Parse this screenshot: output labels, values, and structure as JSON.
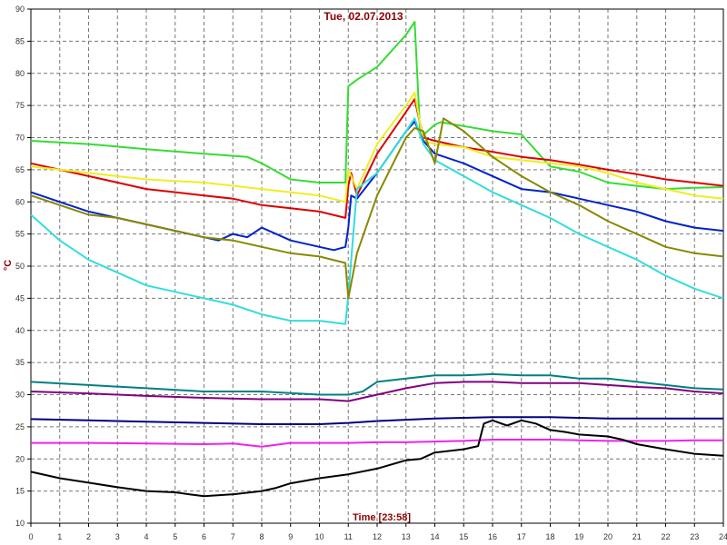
{
  "chart_data": {
    "type": "line",
    "title": "Tue, 02.07.2013",
    "xlabel": "Time [23:58]",
    "ylabel": "°C",
    "xlim": [
      0,
      24
    ],
    "ylim": [
      10,
      90
    ],
    "x_ticks": [
      0,
      1,
      2,
      3,
      4,
      5,
      6,
      7,
      8,
      9,
      10,
      11,
      12,
      13,
      14,
      15,
      16,
      17,
      18,
      19,
      20,
      21,
      22,
      23,
      24
    ],
    "y_ticks": [
      10,
      15,
      20,
      25,
      30,
      35,
      40,
      45,
      50,
      55,
      60,
      65,
      70,
      75,
      80,
      85,
      90
    ],
    "grid": true,
    "series": [
      {
        "color": "#33dd33",
        "x": [
          0,
          2,
          4,
          6,
          7.5,
          8,
          9,
          10,
          10.9,
          11,
          11.3,
          12,
          13,
          13.3,
          13.5,
          14,
          14.2,
          15,
          16,
          17,
          18,
          19,
          20,
          21,
          22,
          23,
          24
        ],
        "y": [
          69.5,
          69,
          68.2,
          67.5,
          67,
          66,
          63.5,
          63,
          63,
          78,
          79,
          81,
          86,
          88,
          70,
          72,
          72.4,
          71.8,
          71,
          70.5,
          65.5,
          64.7,
          63,
          62.5,
          62,
          62.2,
          62.3
        ]
      },
      {
        "color": "#dd0000",
        "x": [
          0,
          1,
          2,
          3,
          4,
          5,
          6,
          7,
          8,
          9,
          10,
          10.9,
          11,
          11.1,
          11.3,
          12,
          13,
          13.3,
          13.6,
          14,
          15,
          16,
          17,
          18,
          19,
          20,
          21,
          22,
          23,
          24
        ],
        "y": [
          66,
          65,
          64,
          63,
          62,
          61.5,
          61,
          60.5,
          59.5,
          59,
          58.5,
          57.5,
          62.5,
          64.5,
          61,
          67.5,
          74,
          76,
          70,
          69.5,
          68.5,
          67.8,
          67,
          66.5,
          65.8,
          65,
          64.3,
          63.5,
          63,
          62.5
        ]
      },
      {
        "color": "#eeee22",
        "x": [
          0,
          2,
          4,
          6,
          8,
          10,
          10.9,
          11,
          11.3,
          12,
          13,
          13.3,
          13.6,
          14,
          15,
          16,
          17,
          18,
          19,
          20,
          21,
          22,
          23,
          24
        ],
        "y": [
          65.5,
          64.5,
          63.5,
          63,
          62,
          61,
          60,
          65,
          62,
          69,
          75,
          77,
          69.5,
          69,
          68.5,
          67,
          66.5,
          66,
          65.5,
          64.5,
          63,
          62,
          61,
          60.5
        ]
      },
      {
        "color": "#0022cc",
        "x": [
          0,
          1,
          2,
          3,
          4,
          5,
          6,
          6.5,
          7,
          7.5,
          8,
          8.5,
          9,
          10,
          10.5,
          10.9,
          11,
          11.1,
          11.3,
          12,
          13,
          13.3,
          13.6,
          14,
          15,
          16,
          17,
          18,
          19,
          20,
          21,
          22,
          23,
          24
        ],
        "y": [
          61.5,
          60,
          58.5,
          57.5,
          56.5,
          55.5,
          54.5,
          54,
          55,
          54.5,
          56,
          55,
          54,
          53,
          52.5,
          53,
          56,
          61,
          60.5,
          64.5,
          71,
          72.5,
          69.5,
          67.5,
          66,
          64,
          62,
          61.5,
          60.5,
          59.5,
          58.5,
          57,
          56,
          55.5
        ]
      },
      {
        "color": "#33dddd",
        "x": [
          0,
          1,
          2,
          3,
          4,
          5,
          6,
          7,
          8,
          9,
          10,
          10.9,
          11,
          11.3,
          12,
          13,
          13.3,
          13.6,
          14,
          15,
          16,
          17,
          18,
          19,
          20,
          21,
          22,
          23,
          24
        ],
        "y": [
          58,
          54,
          51,
          49,
          47,
          46,
          45,
          44,
          42.5,
          41.5,
          41.5,
          41,
          45.5,
          62,
          64.5,
          71,
          73,
          69,
          66.5,
          64,
          61.5,
          59.5,
          57.5,
          55,
          53,
          51,
          48.5,
          46.5,
          45
        ]
      },
      {
        "color": "#888800",
        "x": [
          0,
          1,
          2,
          3,
          4,
          5,
          6,
          7,
          8,
          9,
          10,
          10.9,
          11,
          11.3,
          12,
          13,
          13.3,
          13.6,
          14,
          14.3,
          15,
          16,
          17,
          18,
          19,
          20,
          21,
          22,
          23,
          24
        ],
        "y": [
          61,
          59.5,
          58,
          57.5,
          56.5,
          55.5,
          54.5,
          54,
          53,
          52,
          51.5,
          50.5,
          45,
          52,
          61,
          70,
          71.5,
          71,
          66,
          73,
          71,
          67,
          64,
          61.5,
          59.5,
          57,
          55,
          53,
          52,
          51.5
        ]
      },
      {
        "color": "#008080",
        "x": [
          0,
          2,
          4,
          6,
          8,
          10,
          11,
          11.5,
          12,
          13,
          14,
          15,
          16,
          17,
          18,
          19,
          20,
          21,
          22,
          23,
          24
        ],
        "y": [
          32,
          31.5,
          31,
          30.5,
          30.5,
          30,
          30,
          30.5,
          32,
          32.5,
          33,
          33,
          33.2,
          33,
          33,
          32.5,
          32.5,
          32,
          31.5,
          31,
          30.8
        ]
      },
      {
        "color": "#800080",
        "x": [
          0,
          2,
          4,
          6,
          8,
          10,
          11,
          12,
          13,
          14,
          15,
          16,
          17,
          18,
          19,
          20,
          21,
          22,
          23,
          24
        ],
        "y": [
          30.5,
          30.2,
          29.8,
          29.5,
          29.3,
          29.3,
          29,
          30,
          31,
          31.8,
          32,
          32,
          31.8,
          31.8,
          31.8,
          31.5,
          31.2,
          31,
          30.5,
          30.2
        ]
      },
      {
        "color": "#000080",
        "x": [
          0,
          2,
          4,
          6,
          8,
          10,
          11,
          12,
          13,
          14,
          15,
          16,
          17,
          18,
          19,
          20,
          21,
          22,
          23,
          24
        ],
        "y": [
          26.2,
          26,
          25.8,
          25.6,
          25.4,
          25.4,
          25.6,
          25.9,
          26.1,
          26.3,
          26.4,
          26.5,
          26.5,
          26.5,
          26.4,
          26.3,
          26.3,
          26.3,
          26.3,
          26.3
        ]
      },
      {
        "color": "#ee22ee",
        "x": [
          0,
          2,
          4,
          6,
          7,
          8,
          9,
          10,
          11,
          12,
          13,
          14,
          15,
          16,
          17,
          18,
          19,
          20,
          21,
          22,
          23,
          24
        ],
        "y": [
          22.5,
          22.5,
          22.4,
          22.3,
          22.4,
          21.9,
          22.5,
          22.5,
          22.5,
          22.6,
          22.6,
          22.7,
          22.8,
          23,
          23,
          23,
          22.9,
          22.8,
          22.8,
          22.8,
          22.9,
          22.9
        ]
      },
      {
        "color": "#000000",
        "x": [
          0,
          1,
          2,
          3,
          4,
          5,
          5.5,
          6,
          7,
          8,
          8.5,
          9,
          10,
          11,
          12,
          13,
          13.5,
          14,
          15,
          15.5,
          15.7,
          16,
          16.5,
          17,
          17.5,
          18,
          18.5,
          19,
          20,
          20.5,
          21,
          22,
          23,
          24
        ],
        "y": [
          18,
          17,
          16.3,
          15.6,
          15,
          14.8,
          14.5,
          14.2,
          14.5,
          15,
          15.5,
          16.2,
          17,
          17.6,
          18.5,
          19.8,
          20,
          21,
          21.5,
          22,
          25.5,
          26,
          25.2,
          26,
          25.5,
          24.5,
          24.2,
          23.8,
          23.5,
          23,
          22.3,
          21.5,
          20.8,
          20.5
        ]
      }
    ]
  }
}
